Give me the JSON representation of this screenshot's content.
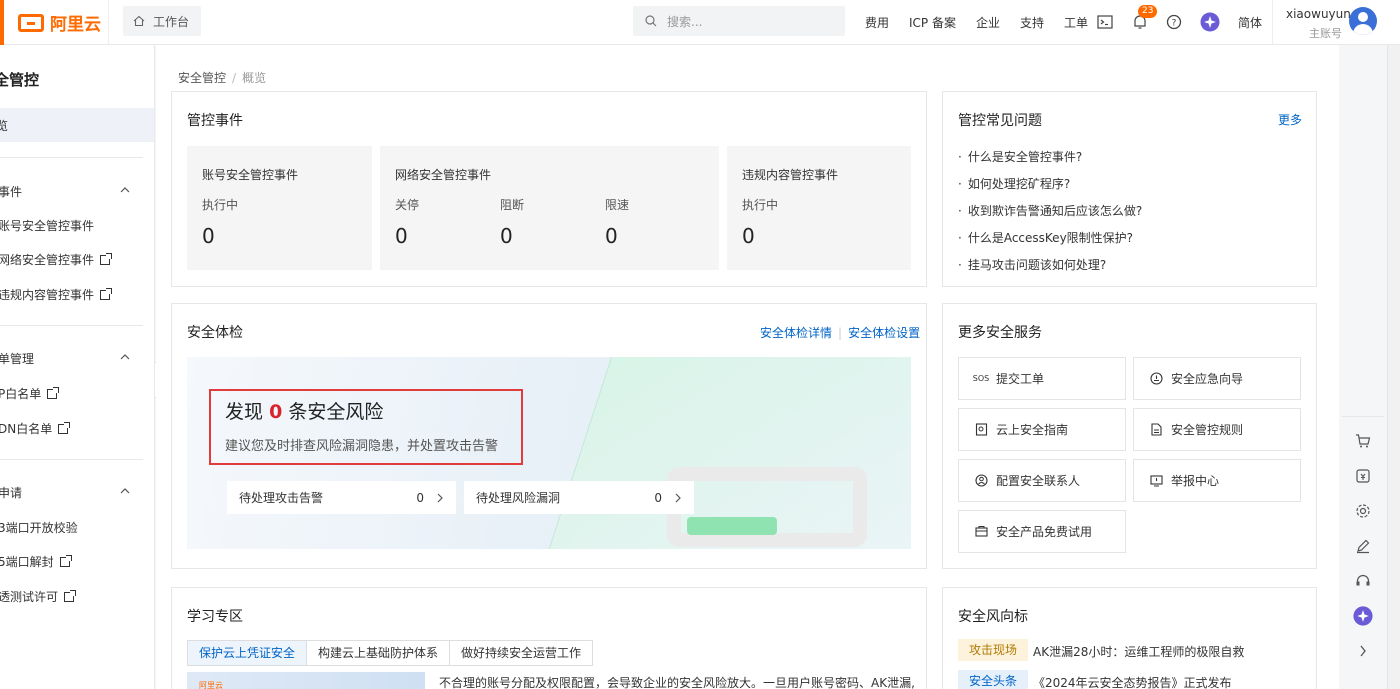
{
  "header": {
    "brand": "阿里云",
    "workbench": "工作台",
    "search_placeholder": "搜索...",
    "links": [
      "费用",
      "ICP 备案",
      "企业",
      "支持",
      "工单"
    ],
    "notification_count": "23",
    "language": "简体",
    "username": "xiaowuyun",
    "account_type": "主账号"
  },
  "sidebar": {
    "title": "全管控",
    "overview": "览",
    "groups": [
      {
        "label": "事件",
        "items": [
          "账号安全管控事件",
          "网络安全管控事件",
          "违规内容管控事件"
        ]
      },
      {
        "label": "单管理",
        "items": [
          "P白名单",
          "DN白名单"
        ]
      },
      {
        "label": "申请",
        "items": [
          "3端口开放校验",
          "5端口解封",
          "透测试许可"
        ]
      }
    ]
  },
  "breadcrumb": {
    "root": "安全管控",
    "current": "概览"
  },
  "events": {
    "title": "管控事件",
    "account": {
      "title": "账号安全管控事件",
      "label": "执行中",
      "value": "0"
    },
    "network": {
      "title": "网络安全管控事件",
      "labels": [
        "关停",
        "阻断",
        "限速"
      ],
      "values": [
        "0",
        "0",
        "0"
      ]
    },
    "content": {
      "title": "违规内容管控事件",
      "label": "执行中",
      "value": "0"
    }
  },
  "faq": {
    "title": "管控常见问题",
    "more": "更多",
    "items": [
      "什么是安全管控事件?",
      "如何处理挖矿程序?",
      "收到欺诈告警通知后应该怎么做?",
      "什么是AccessKey限制性保护?",
      "挂马攻击问题该如何处理?"
    ]
  },
  "checkup": {
    "title": "安全体检",
    "detail_link": "安全体检详情",
    "settings_link": "安全体检设置",
    "headline_prefix": "发现",
    "headline_count": "0",
    "headline_suffix": "条安全风险",
    "subline": "建议您及时排查风险漏洞隐患，并处置攻击告警",
    "pending_alerts_label": "待处理攻击告警",
    "pending_alerts_value": "0",
    "pending_vulns_label": "待处理风险漏洞",
    "pending_vulns_value": "0"
  },
  "services": {
    "title": "更多安全服务",
    "items": [
      {
        "icon": "sos-icon",
        "label": "提交工单"
      },
      {
        "icon": "emergency-icon",
        "label": "安全应急向导"
      },
      {
        "icon": "guide-icon",
        "label": "云上安全指南"
      },
      {
        "icon": "document-icon",
        "label": "安全管控规则"
      },
      {
        "icon": "contact-icon",
        "label": "配置安全联系人"
      },
      {
        "icon": "report-icon",
        "label": "举报中心"
      },
      {
        "icon": "trial-icon",
        "label": "安全产品免费试用"
      }
    ]
  },
  "learning": {
    "title": "学习专区",
    "tabs": [
      "保护云上凭证安全",
      "构建云上基础防护体系",
      "做好持续安全运营工作"
    ],
    "thumb_text": "阿里云",
    "text": "不合理的账号分配及权限配置，会导致企业的安全风险放大。一旦用户账号密码、AK泄漏,"
  },
  "trends": {
    "title": "安全风向标",
    "items": [
      {
        "tag": "攻击现场",
        "text": "AK泄漏28小时：运维工程师的极限自救"
      },
      {
        "tag": "安全头条",
        "text": "《2024年云安全态势报告》正式发布"
      }
    ]
  },
  "colors": {
    "brand": "#ff6a00",
    "link": "#0064c8",
    "risk": "#d9232d"
  }
}
